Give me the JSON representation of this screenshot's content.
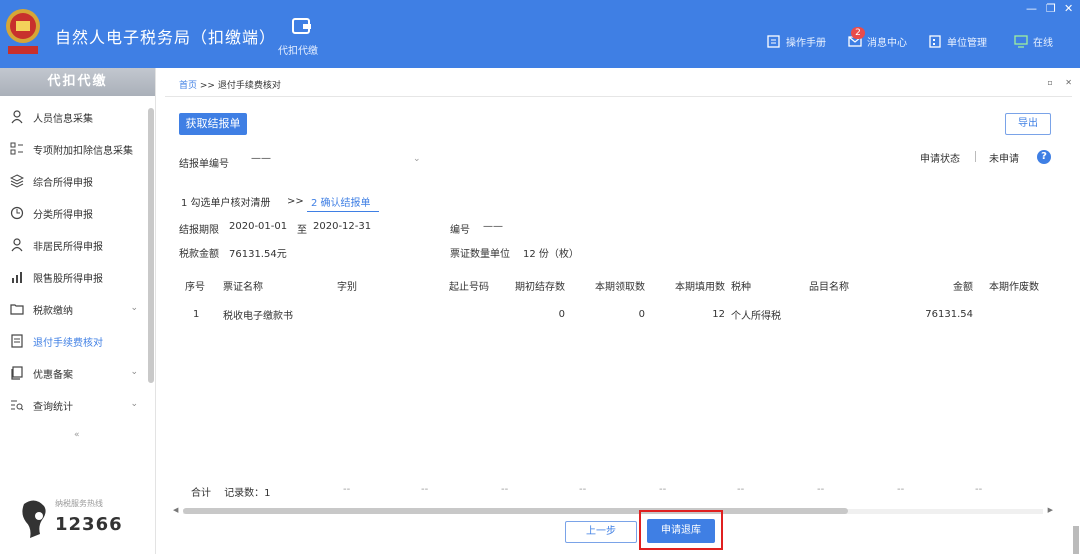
{
  "header": {
    "app_title": "自然人电子税务局（扣缴端）",
    "tool_label": "代扣代缴",
    "manual": "操作手册",
    "messages": "消息中心",
    "message_count": "2",
    "unit_mgmt": "单位管理",
    "online": "在线"
  },
  "sidebar": {
    "title": "代扣代缴",
    "items": [
      {
        "label": "人员信息采集",
        "icon": "person-icon"
      },
      {
        "label": "专项附加扣除信息采集",
        "icon": "grid-icon"
      },
      {
        "label": "综合所得申报",
        "icon": "layers-icon"
      },
      {
        "label": "分类所得申报",
        "icon": "clock-icon"
      },
      {
        "label": "非居民所得申报",
        "icon": "person-icon"
      },
      {
        "label": "限售股所得申报",
        "icon": "bar-chart-icon"
      },
      {
        "label": "税款缴纳",
        "icon": "folder-icon"
      },
      {
        "label": "退付手续费核对",
        "icon": "document-icon"
      },
      {
        "label": "优惠备案",
        "icon": "copy-icon"
      },
      {
        "label": "查询统计",
        "icon": "list-search-icon"
      }
    ],
    "hotline": "12366",
    "hotline_sub": "纳税服务热线"
  },
  "breadcrumb": {
    "home": "首页",
    "sep": ">>",
    "current": "退付手续费核对"
  },
  "toolbar": {
    "fetch_label": "获取结报单",
    "export_label": "导出"
  },
  "form": {
    "report_no_label": "结报单编号",
    "report_no_value": "——",
    "status_label": "申请状态",
    "status_value": "未申请",
    "period_label": "结报期限",
    "period_from": "2020-01-01",
    "period_to_word": "至",
    "period_to": "2020-12-31",
    "code_label": "编号",
    "code_value": "——",
    "tax_amount_label": "税款金额",
    "tax_amount_value": "76131.54元",
    "ticket_count_label": "票证数量单位",
    "ticket_count_value": "12 份（枚）"
  },
  "steps": {
    "step1": "1 勾选单户核对清册",
    "arrow": ">>",
    "step2": "2 确认结报单"
  },
  "table": {
    "headers": [
      "序号",
      "票证名称",
      "字别",
      "起止号码",
      "期初结存数",
      "本期领取数",
      "本期填用数",
      "税种",
      "品目名称",
      "金额",
      "本期作废数"
    ],
    "rows": [
      [
        "1",
        "税收电子缴款书",
        "",
        "",
        "0",
        "0",
        "12",
        "个人所得税",
        "",
        "76131.54",
        ""
      ]
    ],
    "total_label": "合计",
    "record_count": "记录数：1",
    "dash": "--"
  },
  "footer": {
    "prev_label": "上一步",
    "apply_label": "申请退库"
  }
}
